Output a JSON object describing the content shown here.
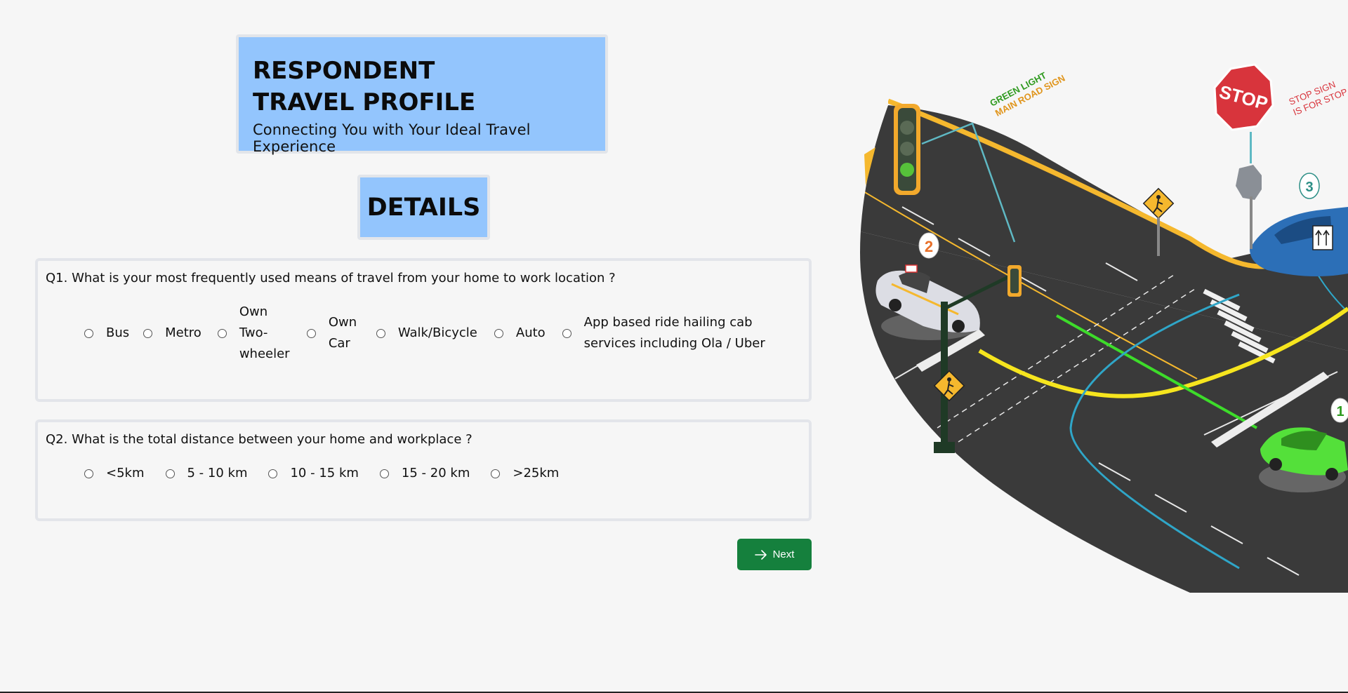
{
  "header": {
    "title_line1": "RESPONDENT",
    "title_line2": "TRAVEL PROFILE",
    "subtitle": "Connecting You with Your Ideal Travel Experience"
  },
  "details": {
    "title": "DETAILS"
  },
  "questions": [
    {
      "text": "Q1. What is your most frequently used means of travel from your home to work location ?",
      "options": [
        "Bus",
        "Metro",
        "Own Two-wheeler",
        "Own Car",
        "Walk/Bicycle",
        "Auto",
        "App based ride hailing cab services including Ola / Uber"
      ]
    },
    {
      "text": "Q2. What is the total distance between your home and workplace ?",
      "options": [
        "<5km",
        "5 - 10 km",
        "10 - 15 km",
        "15 - 20 km",
        ">25km"
      ]
    }
  ],
  "next_button": {
    "label": "Next",
    "icon": "arrow-right-icon"
  },
  "illustration": {
    "labels": {
      "green_light": "GREEN LIGHT",
      "main_road_sign": "MAIN ROAD SIGN",
      "stop_sign_text": "STOP",
      "stop_sign_caption": "STOP SIGN",
      "stop_sign_caption2": "IS FOR STOP A",
      "marker1": "1",
      "marker2": "2",
      "marker3": "3"
    },
    "colors": {
      "road": "#3a3a3a",
      "curb": "#f5b82e",
      "stop": "#d8343c",
      "green_car": "#54e03a",
      "blue_car": "#2c6fb7"
    }
  },
  "colors": {
    "header_bg": "#93c5fd",
    "next_bg": "#15803d",
    "page_bg": "#f6f6f6"
  }
}
